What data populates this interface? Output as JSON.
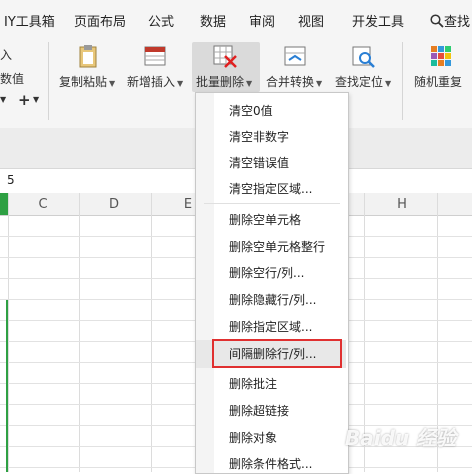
{
  "menubar": {
    "items": [
      "IY工具箱",
      "页面布局",
      "公式",
      "数据",
      "审阅",
      "视图",
      "开发工具"
    ],
    "search_label": "查找"
  },
  "ribbon": {
    "left_labels": [
      "入",
      "数值"
    ],
    "plus": "+",
    "buttons": [
      "复制粘贴",
      "新增插入",
      "批量删除",
      "合并转换",
      "查找定位",
      "随机重复"
    ]
  },
  "formula": {
    "value": "5"
  },
  "columns": [
    "C",
    "D",
    "E",
    "H"
  ],
  "dropdown": {
    "items": [
      "清空0值",
      "清空非数字",
      "清空错误值",
      "清空指定区域...",
      "删除空单元格",
      "删除空单元格整行",
      "删除空行/列...",
      "删除隐藏行/列...",
      "删除指定区域...",
      "间隔删除行/列...",
      "删除批注",
      "删除超链接",
      "删除对象",
      "删除条件格式..."
    ],
    "highlighted": "间隔删除行/列..."
  },
  "watermark": "Baidu 经验",
  "colors": {
    "highlight_box": "#e03030",
    "green_selection": "#2ea043"
  }
}
